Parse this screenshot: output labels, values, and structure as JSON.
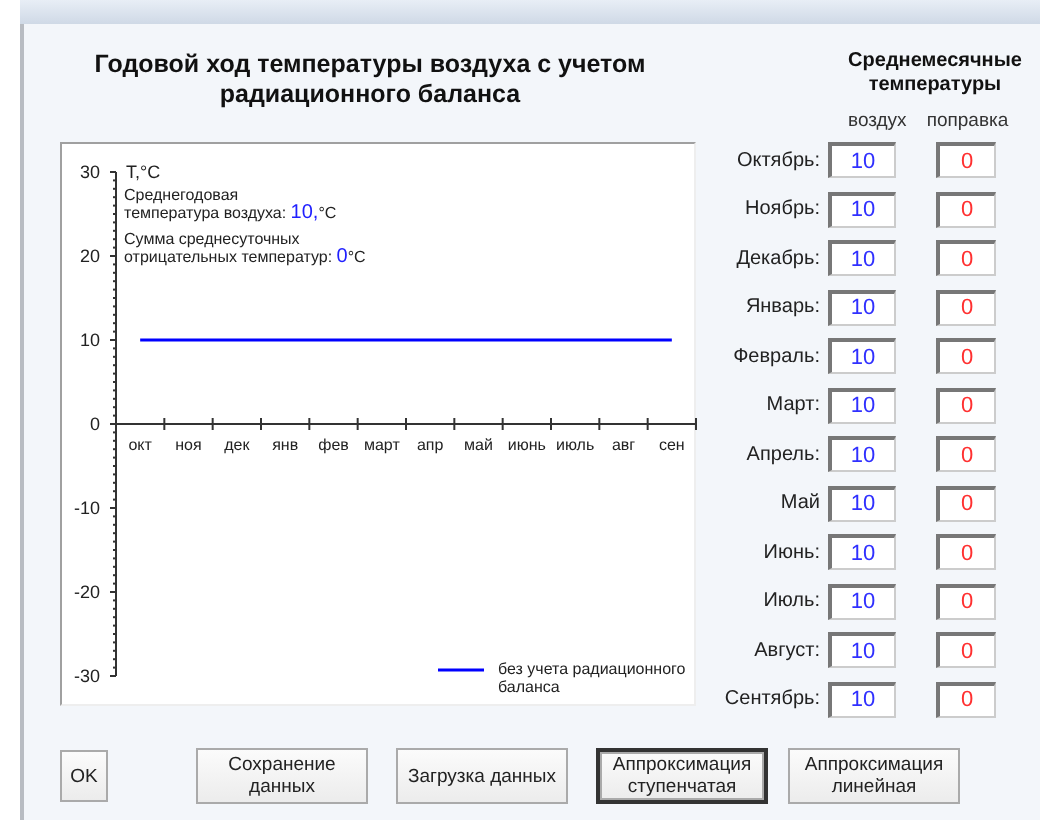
{
  "title": "Годовой ход температуры воздуха с учетом радиационного баланса",
  "chart": {
    "annotations": [
      {
        "lines": [
          "Среднегодовая",
          "температура воздуха: "
        ],
        "value": "10,",
        "unit": "°C"
      },
      {
        "lines": [
          "Сумма среднесуточных",
          "отрицательных температур: "
        ],
        "value": "0",
        "unit": "°C"
      }
    ],
    "chart_data": {
      "type": "line",
      "ylabel": "T,°C",
      "categories": [
        "окт",
        "ноя",
        "дек",
        "янв",
        "фев",
        "март",
        "апр",
        "май",
        "июнь",
        "июль",
        "авг",
        "сен"
      ],
      "ylim": [
        -30,
        30
      ],
      "yticks": [
        -30,
        -20,
        -10,
        0,
        10,
        20,
        30
      ],
      "series": [
        {
          "name": "без учета радиационного баланса",
          "color": "#0000ff",
          "values": [
            10,
            10,
            10,
            10,
            10,
            10,
            10,
            10,
            10,
            10,
            10,
            10
          ]
        }
      ]
    }
  },
  "monthly": {
    "title": "Среднемесячные температуры",
    "columns": [
      "воздух",
      "поправка"
    ],
    "rows": [
      {
        "label": "Октябрь:",
        "air": "10",
        "correction": "0"
      },
      {
        "label": "Ноябрь:",
        "air": "10",
        "correction": "0"
      },
      {
        "label": "Декабрь:",
        "air": "10",
        "correction": "0"
      },
      {
        "label": "Январь:",
        "air": "10",
        "correction": "0"
      },
      {
        "label": "Февраль:",
        "air": "10",
        "correction": "0"
      },
      {
        "label": "Март:",
        "air": "10",
        "correction": "0"
      },
      {
        "label": "Апрель:",
        "air": "10",
        "correction": "0"
      },
      {
        "label": "Май",
        "air": "10",
        "correction": "0"
      },
      {
        "label": "Июнь:",
        "air": "10",
        "correction": "0"
      },
      {
        "label": "Июль:",
        "air": "10",
        "correction": "0"
      },
      {
        "label": "Август:",
        "air": "10",
        "correction": "0"
      },
      {
        "label": "Сентябрь:",
        "air": "10",
        "correction": "0"
      }
    ]
  },
  "buttons": [
    {
      "label": "OK",
      "default": false
    },
    {
      "label": "Сохранение данных",
      "default": false
    },
    {
      "label": "Загрузка данных",
      "default": false
    },
    {
      "label": "Аппроксимация ступенчатая",
      "default": true
    },
    {
      "label": "Аппроксимация линейная",
      "default": false
    }
  ]
}
